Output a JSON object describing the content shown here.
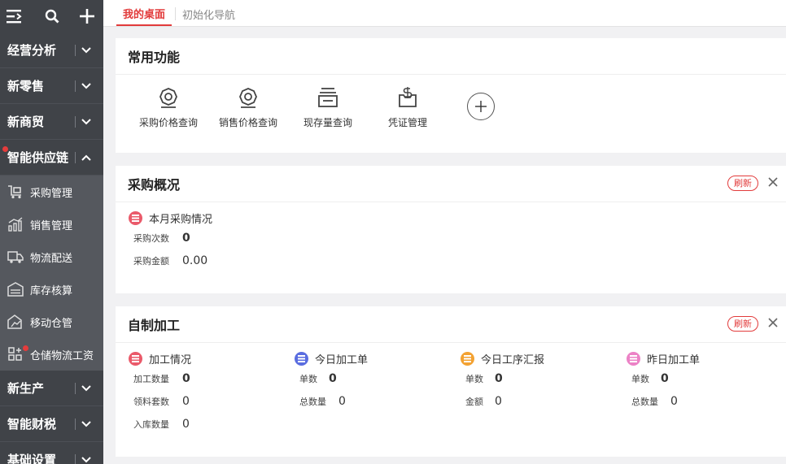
{
  "sidebar": {
    "groups_top": [
      {
        "label": "经营分析"
      },
      {
        "label": "新零售"
      },
      {
        "label": "新商贸"
      },
      {
        "label": "智能供应链"
      }
    ],
    "subs": [
      {
        "label": "采购管理",
        "icon": "purchase-icon"
      },
      {
        "label": "销售管理",
        "icon": "sales-chart-icon"
      },
      {
        "label": "物流配送",
        "icon": "truck-icon"
      },
      {
        "label": "库存核算",
        "icon": "warehouse-icon"
      },
      {
        "label": "移动仓管",
        "icon": "mobile-warehouse-icon"
      },
      {
        "label": "仓储物流工资",
        "icon": "grid-plus-icon"
      }
    ],
    "groups_bottom": [
      {
        "label": "新生产"
      },
      {
        "label": "智能财税"
      },
      {
        "label": "基础设置"
      }
    ]
  },
  "tabs": [
    {
      "label": "我的桌面"
    },
    {
      "label": "初始化导航"
    }
  ],
  "common": {
    "title": "常用功能",
    "items": [
      {
        "label": "采购价格查询",
        "icon": "price-gear-icon"
      },
      {
        "label": "销售价格查询",
        "icon": "price-gear-icon"
      },
      {
        "label": "现存量查询",
        "icon": "stock-icon"
      },
      {
        "label": "凭证管理",
        "icon": "voucher-icon"
      }
    ]
  },
  "purchase": {
    "title": "采购概况",
    "refresh": "刷新",
    "section": {
      "title": "本月采购情况",
      "rows": [
        {
          "k": "采购次数",
          "v": "0"
        },
        {
          "k": "采购金额",
          "v": "0.00"
        }
      ]
    }
  },
  "process": {
    "title": "自制加工",
    "refresh": "刷新",
    "sections": [
      {
        "title": "加工情况",
        "color": "#ea5a6a",
        "rows": [
          {
            "k": "加工数量",
            "v": "0"
          },
          {
            "k": "领料套数",
            "v": "0"
          },
          {
            "k": "入库数量",
            "v": "0"
          }
        ]
      },
      {
        "title": "今日加工单",
        "color": "#5a6de0",
        "rows": [
          {
            "k": "单数",
            "v": "0"
          },
          {
            "k": "总数量",
            "v": "0"
          }
        ]
      },
      {
        "title": "今日工序汇报",
        "color": "#f3a232",
        "rows": [
          {
            "k": "单数",
            "v": "0"
          },
          {
            "k": "金额",
            "v": "0"
          }
        ]
      },
      {
        "title": "昨日加工单",
        "color": "#ec82c6",
        "rows": [
          {
            "k": "单数",
            "v": "0"
          },
          {
            "k": "总数量",
            "v": "0"
          }
        ]
      }
    ]
  },
  "colors": {
    "accent": "#e23b3b",
    "sidebar": "#404348",
    "sidebar_sub": "#55585e"
  }
}
